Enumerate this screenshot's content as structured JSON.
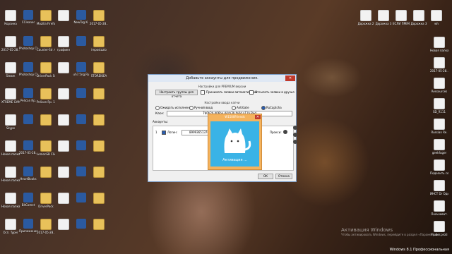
{
  "dialog": {
    "title": "Добавьте аккаунты для продвижения.",
    "premium_label": "Настройки для PREMIUM версии",
    "groups_button": "Настроить группы для отчета",
    "option_accept": "Принимать заявки автоматически",
    "option_send": "Отсылать заявки в друзья",
    "captcha_label": "Настройки ввода капчи",
    "captcha_modes": [
      "Ожидать исполнения",
      "Ручной ввод",
      "AntiGate",
      "RuCaptcha"
    ],
    "key_label": "Ключ:",
    "key_value": "7b0b2b d06ba  d4cb3b fa0d a11b Red",
    "accounts_label": "Аккаунты:",
    "account_row": {
      "num": "1",
      "name_label": "Логин:",
      "login": "89993651370",
      "proxy_label": "Прокси:"
    },
    "ok_button": "ОК",
    "cancel_button": "Отмена"
  },
  "popup": {
    "title": "W1500Friends",
    "activation": "Активация ..."
  },
  "desktop_icons": [
    "Корзина",
    "CCleaner",
    "Mozilla Firefox",
    "",
    "NewTag К.",
    "2017-05-28...",
    "2017-05-28...",
    "Photoshop CS6 wid.",
    "Counter-Str. Global Off.",
    "графикн",
    "",
    "impostazio",
    "Steam",
    "Photoshop CS6",
    "DriverPack Solution",
    "",
    "uh7.5ng.Ru",
    "STOREIKEA",
    "XTREME GAMI...",
    "Pelican Rp.",
    "Pelican Rp. 112.114 ...",
    "",
    "",
    "",
    "Skype",
    "",
    "",
    "",
    "",
    "",
    "Новая папка",
    "2017-05-28...",
    "LemonSB Client",
    "",
    "",
    "",
    "Новая папка",
    "HeartBooks",
    "",
    "",
    "",
    "",
    "Новая папка",
    "BitComet",
    "DriverPack",
    "",
    "",
    "",
    "Осп. Typer",
    "Приложения Windows",
    "2017-05-28...",
    "",
    "",
    ""
  ],
  "right_icons": [
    "Дорожка 2",
    "Дорожка 3",
    "ЕСЛИ ПРЕМ",
    "Дорожка 3",
    "wh",
    "Новая папка",
    "2017-05-28...",
    "Ressources",
    "SD_R111",
    "Russian Re.",
    "geekfuger",
    "Поделить сообщения",
    "ИНСТ Dr Одинэнси",
    "Пользоват.",
    "Fruder.proti"
  ],
  "watermark": {
    "line1": "Активация Windows",
    "line2": "Чтобы активировать Windows, перейдите в раздел «Параметры»."
  },
  "taskbar": {
    "os_label": "Windows 8.1 Профессиональная"
  }
}
